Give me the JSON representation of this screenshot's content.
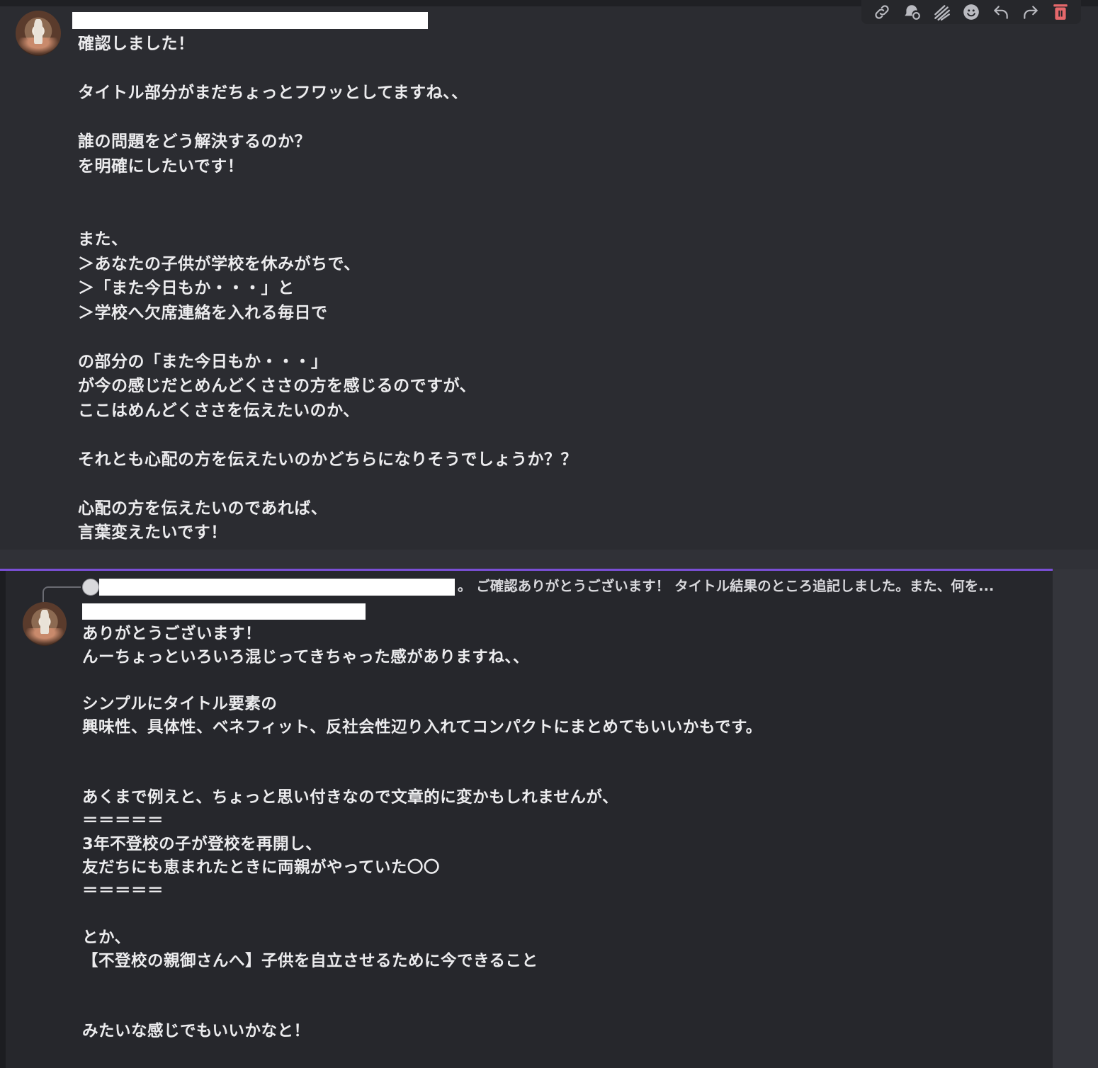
{
  "toolbar": {
    "icons": [
      "link-icon",
      "thread-icon",
      "mark-icon",
      "emoji-icon",
      "reply-icon",
      "forward-icon",
      "delete-icon"
    ]
  },
  "message1": {
    "body": "確認しました！\n\nタイトル部分がまだちょっとフワッとしてますね、、\n\n誰の問題をどう解決するのか？\nを明確にしたいです！\n\n\nまた、\n＞あなたの子供が学校を休みがちで、\n＞「また今日もか・・・」と\n＞学校へ欠席連絡を入れる毎日で\n\nの部分の「また今日もか・・・」\nが今の感じだとめんどくささの方を感じるのですが、\nここはめんどくささを伝えたいのか、\n\nそれとも心配の方を伝えたいのかどちらになりそうでしょうか？？\n\n心配の方を伝えたいのであれば、\n言葉変えたいです！"
  },
  "message2": {
    "reply_preview": "。 ご確認ありがとうございます！ タイトル結果のところ追記しました。また、何を...",
    "body": "ありがとうございます！\nんーちょっといろいろ混じってきちゃった感がありますね、、\n\nシンプルにタイトル要素の\n興味性、具体性、ベネフィット、反社会性辺り入れてコンパクトにまとめてもいいかもです。\n\n\nあくまで例えと、ちょっと思い付きなので文章的に変かもしれませんが、\n＝＝＝＝＝\n3年不登校の子が登校を再開し、\n友だちにも恵まれたときに両親がやっていた〇〇\n＝＝＝＝＝\n\nとか、\n【不登校の親御さんへ】子供を自立させるために今できること\n\n\nみたいな感じでもいいかなと！"
  },
  "colors": {
    "background": "#2b2c31",
    "highlight_background": "#26272c",
    "accent": "#7a4fd6",
    "delete": "#e5686b"
  }
}
